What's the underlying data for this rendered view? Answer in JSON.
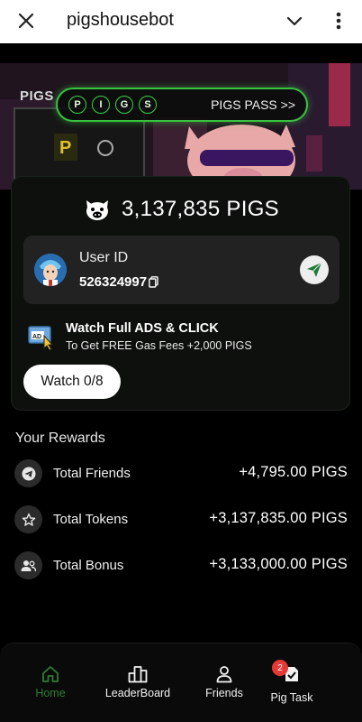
{
  "app": {
    "title": "pigshousebot"
  },
  "banner": {
    "pigs_badge": "PIGS",
    "pass_letters": [
      "P",
      "I",
      "G",
      "S"
    ],
    "pass_label": "PIGS PASS >>"
  },
  "balance": {
    "amount": "3,137,835 PIGS"
  },
  "user": {
    "id_label": "User ID",
    "id_value": "526324997"
  },
  "ads": {
    "title": "Watch Full ADS & CLICK",
    "subtitle": "To Get FREE Gas Fees +2,000 PIGS",
    "watch_label": "Watch 0/8"
  },
  "rewards": {
    "title": "Your Rewards",
    "items": [
      {
        "label": "Total Friends",
        "value": "+4,795.00 PIGS",
        "icon": "telegram-icon"
      },
      {
        "label": "Total Tokens",
        "value": "+3,137,835.00 PIGS",
        "icon": "star-icon"
      },
      {
        "label": "Total Bonus",
        "value": "+3,133,000.00 PIGS",
        "icon": "people-icon"
      }
    ]
  },
  "nav": {
    "items": [
      {
        "label": "Home",
        "icon": "home-icon",
        "active": true
      },
      {
        "label": "LeaderBoard",
        "icon": "leaderboard-icon"
      },
      {
        "label": "Friends",
        "icon": "person-icon"
      },
      {
        "label": "Pig Task",
        "icon": "task-icon",
        "badge": "2"
      }
    ]
  },
  "colors": {
    "accent_green": "#39c23f",
    "active_nav": "#2f7d33",
    "badge_red": "#e53935"
  }
}
